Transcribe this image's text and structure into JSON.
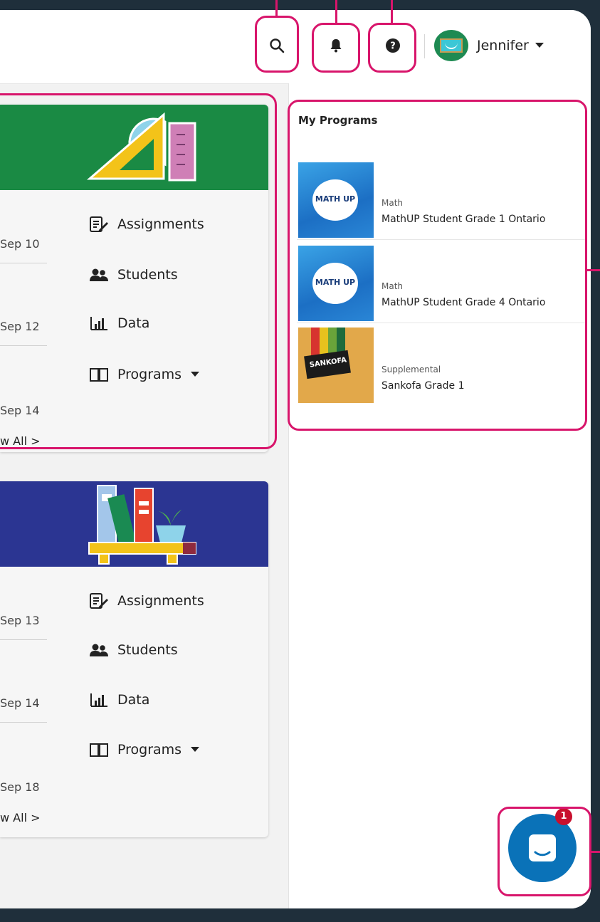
{
  "header": {
    "user_name": "Jennifer"
  },
  "class_cards": [
    {
      "header_color": "#1a8a44",
      "dates": [
        "Sep 10",
        "Sep 12",
        "Sep 14"
      ],
      "view_all": "w All >",
      "nav": {
        "assignments": "Assignments",
        "students": "Students",
        "data": "Data",
        "programs": "Programs"
      }
    },
    {
      "header_color": "#2b3592",
      "dates": [
        "Sep 13",
        "Sep 14",
        "Sep 18"
      ],
      "view_all": "w All >",
      "nav": {
        "assignments": "Assignments",
        "students": "Students",
        "data": "Data",
        "programs": "Programs"
      }
    }
  ],
  "my_programs": {
    "title": "My Programs",
    "items": [
      {
        "category": "Math",
        "name": "MathUP Student Grade 1 Ontario",
        "logo": "MATH UP"
      },
      {
        "category": "Math",
        "name": "MathUP Student Grade 4 Ontario",
        "logo": "MATH UP"
      },
      {
        "category": "Supplemental",
        "name": "Sankofa Grade 1",
        "logo": "SANKOFA"
      }
    ]
  },
  "chat": {
    "badge_count": "1"
  },
  "colors": {
    "highlight": "#d8156b",
    "card1_header": "#1a8a44",
    "card2_header": "#2b3592",
    "chat_button": "#0a72b8"
  }
}
